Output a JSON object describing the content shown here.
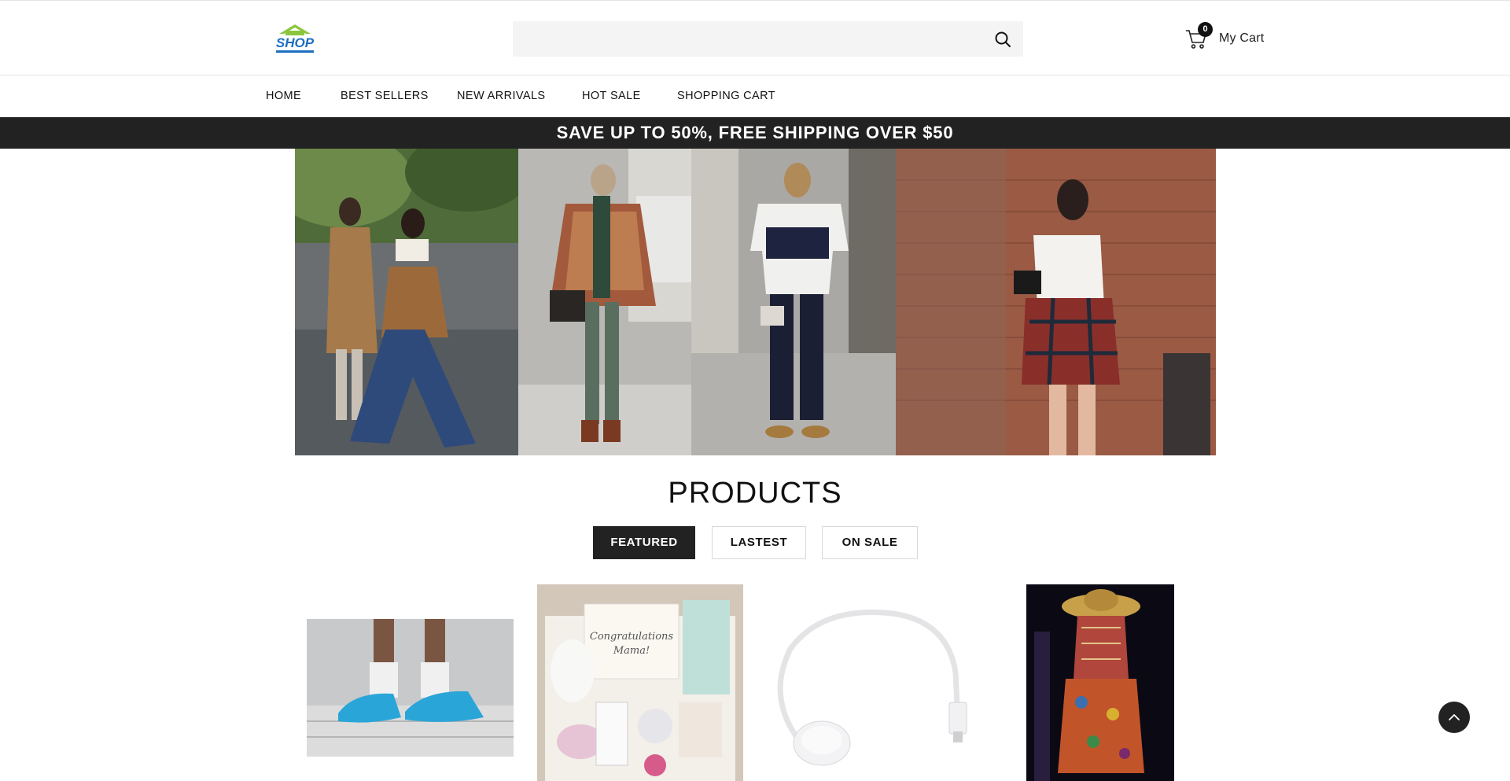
{
  "header": {
    "logo_text": "SHOP",
    "search": {
      "placeholder": "",
      "value": ""
    },
    "cart": {
      "count": "0",
      "label": "My Cart"
    }
  },
  "nav": {
    "items": [
      {
        "label": "HOME"
      },
      {
        "label": "BEST SELLERS"
      },
      {
        "label": "NEW ARRIVALS"
      },
      {
        "label": "HOT SALE"
      },
      {
        "label": "SHOPPING CART"
      }
    ]
  },
  "promo": {
    "text": "SAVE UP TO 50%, FREE SHIPPING OVER $50"
  },
  "products": {
    "title": "PRODUCTS",
    "tabs": [
      {
        "label": "FEATURED",
        "active": true
      },
      {
        "label": "LASTEST",
        "active": false
      },
      {
        "label": "ON SALE",
        "active": false
      }
    ]
  },
  "colors": {
    "dark": "#222222",
    "logo_green": "#8cc63f",
    "logo_blue": "#1e6fc0",
    "search_bg": "#f4f4f4"
  },
  "icons": [
    "search-icon",
    "cart-icon",
    "chevron-up-icon"
  ]
}
